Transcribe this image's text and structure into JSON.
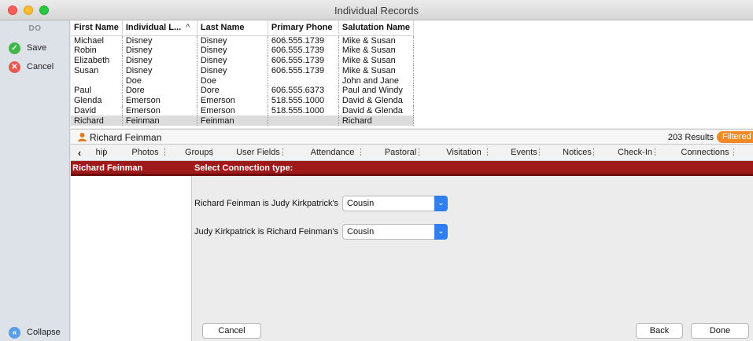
{
  "window": {
    "title": "Individual Records"
  },
  "sidebar": {
    "header": "DO",
    "save_label": "Save",
    "cancel_label": "Cancel",
    "collapse_label": "Collapse"
  },
  "table": {
    "columns": [
      "First Name",
      "Individual L...",
      "Last Name",
      "Primary Phone",
      "Salutation Name"
    ],
    "rows": [
      [
        "Michael",
        "Disney",
        "Disney",
        "606.555.1739",
        "Mike & Susan"
      ],
      [
        "Robin",
        "Disney",
        "Disney",
        "606.555.1739",
        "Mike & Susan"
      ],
      [
        "Elizabeth",
        "Disney",
        "Disney",
        "606.555.1739",
        "Mike & Susan"
      ],
      [
        "Susan",
        "Disney",
        "Disney",
        "606.555.1739",
        "Mike & Susan"
      ],
      [
        "",
        "Doe",
        "Doe",
        "",
        "John and Jane"
      ],
      [
        "Paul",
        "Dore",
        "Dore",
        "606.555.6373",
        "Paul and Windy"
      ],
      [
        "Glenda",
        "Emerson",
        "Emerson",
        "518.555.1000",
        "David & Glenda"
      ],
      [
        "David",
        "Emerson",
        "Emerson",
        "518.555.1000",
        "David & Glenda"
      ],
      [
        "Richard",
        "Feinman",
        "Feinman",
        "",
        "Richard"
      ]
    ]
  },
  "record": {
    "name": "Richard Feinman",
    "results": "203 Results",
    "filter_badge": "Filtered"
  },
  "tabs": [
    "hip",
    "Photos",
    "Groups",
    "User Fields",
    "Attendance",
    "Pastoral",
    "Visitation",
    "Events",
    "Notices",
    "Check-In",
    "Connections"
  ],
  "connection": {
    "person": "Richard Feinman",
    "prompt": "Select Connection type:",
    "row1_label": "Richard Feinman is Judy Kirkpatrick's",
    "row1_value": "Cousin",
    "row2_label": "Judy Kirkpatrick is Richard Feinman's",
    "row2_value": "Cousin",
    "cancel_label": "Cancel",
    "back_label": "Back",
    "done_label": "Done"
  }
}
